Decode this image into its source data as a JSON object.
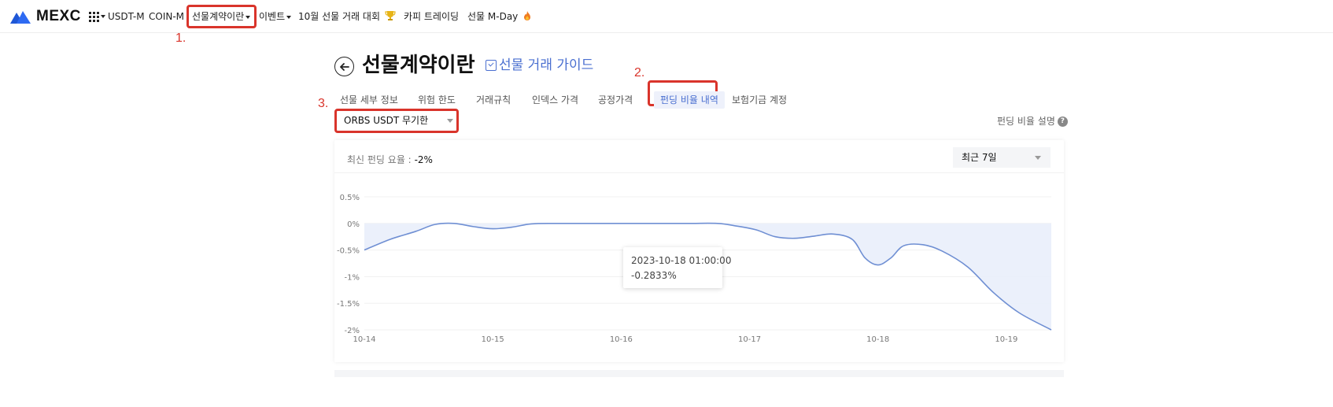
{
  "nav": {
    "logo": "MEXC",
    "items": [
      {
        "label": "USDT-M"
      },
      {
        "label": "COIN-M"
      },
      {
        "label": "선물계약이란"
      },
      {
        "label": "이벤트"
      },
      {
        "label": "10월 선물 거래 대회"
      },
      {
        "label": "카피 트레이딩"
      },
      {
        "label": "선물 M-Day"
      }
    ]
  },
  "steps": [
    "1.",
    "2.",
    "3."
  ],
  "header": {
    "back_icon": "arrow-left-icon",
    "title": "선물계약이란",
    "guide_link": "선물 거래 가이드"
  },
  "tabs": [
    {
      "label": "선물 세부 정보",
      "active": false
    },
    {
      "label": "위험 한도",
      "active": false
    },
    {
      "label": "거래규칙",
      "active": false
    },
    {
      "label": "인덱스 가격",
      "active": false
    },
    {
      "label": "공정가격",
      "active": false
    },
    {
      "label": "펀딩 비율 내역",
      "active": true
    },
    {
      "label": "보험기금 계정",
      "active": false
    }
  ],
  "contract_select": {
    "value": "ORBS USDT 무기한"
  },
  "help_link": "펀딩 비율 설명",
  "card": {
    "latest_label": "최신 펀딩 요율 :",
    "latest_value": "-2%",
    "range_select": "최근 7일"
  },
  "tooltip": {
    "time": "2023-10-18 01:00:00",
    "value": "-0.2833%"
  },
  "colors": {
    "accent": "#4a6fd0",
    "highlight": "#d9342b",
    "line": "#6f8fd3",
    "fill": "#e9eefb"
  },
  "chart_data": {
    "type": "area",
    "x_ticks": [
      "10-14",
      "10-15",
      "10-16",
      "10-17",
      "10-18",
      "10-19"
    ],
    "y_ticks": [
      "0.5%",
      "0%",
      "-0.5%",
      "-1%",
      "-1.5%",
      "-2%"
    ],
    "ylim": [
      -2,
      0.5
    ],
    "series": [
      {
        "values": [
          [
            0,
            -0.5
          ],
          [
            0.2,
            -0.3
          ],
          [
            0.4,
            -0.15
          ],
          [
            0.55,
            -0.02
          ],
          [
            0.7,
            0
          ],
          [
            0.85,
            -0.06
          ],
          [
            1.0,
            -0.1
          ],
          [
            1.15,
            -0.07
          ],
          [
            1.3,
            -0.01
          ],
          [
            1.5,
            0
          ],
          [
            2.0,
            0
          ],
          [
            2.5,
            0
          ],
          [
            2.75,
            0
          ],
          [
            2.9,
            -0.05
          ],
          [
            3.05,
            -0.12
          ],
          [
            3.2,
            -0.25
          ],
          [
            3.35,
            -0.28
          ],
          [
            3.5,
            -0.24
          ],
          [
            3.65,
            -0.2
          ],
          [
            3.8,
            -0.3
          ],
          [
            3.9,
            -0.65
          ],
          [
            4.0,
            -0.78
          ],
          [
            4.1,
            -0.65
          ],
          [
            4.2,
            -0.42
          ],
          [
            4.35,
            -0.4
          ],
          [
            4.5,
            -0.52
          ],
          [
            4.7,
            -0.82
          ],
          [
            4.9,
            -1.3
          ],
          [
            5.1,
            -1.68
          ],
          [
            5.35,
            -2.0
          ]
        ]
      }
    ]
  }
}
